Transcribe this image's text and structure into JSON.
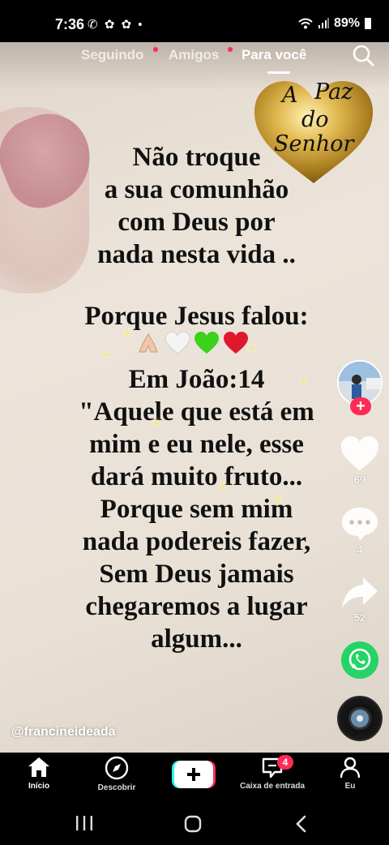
{
  "status_bar": {
    "time": "7:36",
    "notification_icons": "✆ ✿ ✿ •",
    "battery": "89%"
  },
  "feed_tabs": {
    "following": "Seguindo",
    "friends": "Amigos",
    "for_you": "Para você"
  },
  "sticker": {
    "line1": "A",
    "line2": "Paz",
    "line3": "do",
    "line4": "Senhor"
  },
  "message": {
    "p1": [
      "Não troque",
      "a sua comunhão",
      "com Deus por",
      "nada nesta vida .."
    ],
    "p2": "Porque Jesus falou:",
    "emojis": [
      "folded-hands",
      "white-heart",
      "green-heart",
      "red-heart"
    ],
    "p3": [
      "Em João:14",
      "\"Aquele que está em",
      "mim e eu nele, esse",
      "dará muito fruto...",
      "Porque sem mim",
      "nada podereis fazer,",
      "Sem Deus jamais",
      "chegaremos a lugar",
      "algum..."
    ]
  },
  "actions": {
    "like_count": "69",
    "comment_count": "4",
    "share_count": "52"
  },
  "post": {
    "username": "@francineideada"
  },
  "bottom_nav": {
    "home": "Início",
    "discover": "Descobrir",
    "create": "+",
    "inbox": "Caixa de entrada",
    "inbox_badge": "4",
    "profile": "Eu"
  },
  "colors": {
    "accent": "#fe2c55",
    "whatsapp": "#25d366",
    "heart_gold": "#c9a135"
  }
}
